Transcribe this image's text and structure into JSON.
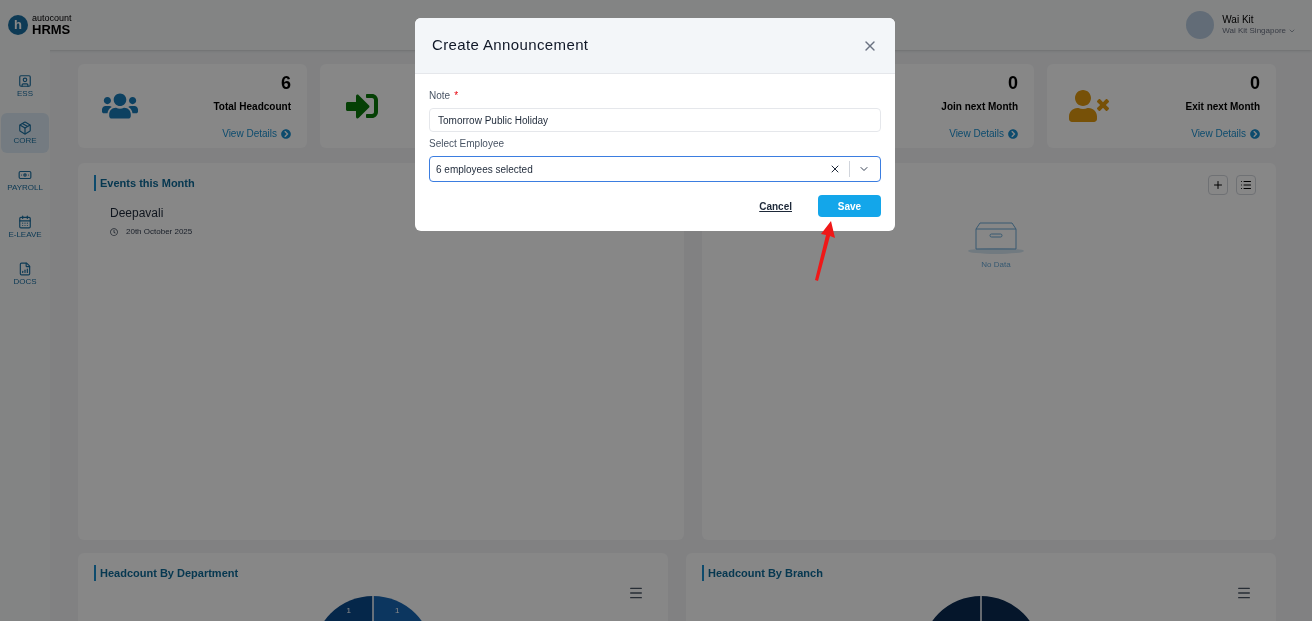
{
  "header": {
    "logo_mark": "h",
    "logo_top": "autocount",
    "logo_bottom": "HRMS",
    "user": {
      "name": "Wai Kit",
      "company": "Wai Kit Singapore"
    }
  },
  "sidebar": {
    "items": [
      {
        "label": "ESS",
        "kind": "ess",
        "selected": false
      },
      {
        "label": "CORE",
        "kind": "core",
        "selected": true
      },
      {
        "label": "PAYROLL",
        "kind": "payroll",
        "selected": false
      },
      {
        "label": "E-LEAVE",
        "kind": "leave",
        "selected": false
      },
      {
        "label": "DOCS",
        "kind": "docs",
        "selected": false
      }
    ]
  },
  "stat_cards": [
    {
      "kind": "users",
      "value": "6",
      "label": "Total Headcount",
      "link": "View Details"
    },
    {
      "kind": "enter"
    },
    {
      "kind": "plain",
      "value": "0",
      "label": "Join next Month",
      "link": "View Details"
    },
    {
      "kind": "user_x",
      "value": "0",
      "label": "Exit next Month",
      "link": "View Details"
    }
  ],
  "events_panel": {
    "title": "Events this Month",
    "events": [
      {
        "name": "Deepavali",
        "date": "20th October 2025"
      }
    ]
  },
  "announcement_panel": {
    "empty_text": "No Data"
  },
  "charts": [
    {
      "title": "Headcount By Department",
      "kind": "pie",
      "slice_labels": [
        "1",
        "1"
      ]
    },
    {
      "title": "Headcount By Branch",
      "kind": "donut"
    }
  ],
  "dialog": {
    "title": "Create Announcement",
    "note_label": "Note",
    "note_required_mark": "*",
    "note_value": "Tomorrow Public Holiday",
    "employee_label": "Select Employee",
    "employee_value": "6 employees selected",
    "buttons": [
      {
        "label": "Cancel",
        "kind": "link"
      },
      {
        "label": "Save",
        "kind": "primary"
      }
    ]
  },
  "annotation": {
    "kind": "arrow"
  }
}
